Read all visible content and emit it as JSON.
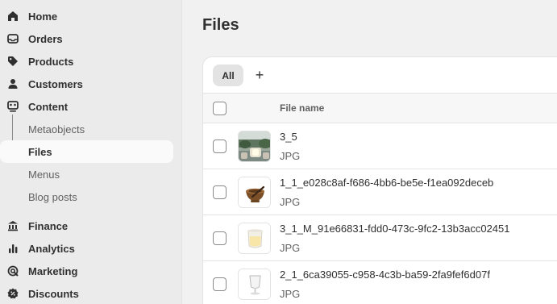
{
  "sidebar": {
    "main_items": [
      {
        "label": "Home",
        "icon": "home-icon"
      },
      {
        "label": "Orders",
        "icon": "inbox-icon"
      },
      {
        "label": "Products",
        "icon": "tag-icon"
      },
      {
        "label": "Customers",
        "icon": "person-icon"
      },
      {
        "label": "Content",
        "icon": "content-icon"
      }
    ],
    "sub_items": [
      {
        "label": "Metaobjects"
      },
      {
        "label": "Files"
      },
      {
        "label": "Menus"
      },
      {
        "label": "Blog posts"
      }
    ],
    "lower_items": [
      {
        "label": "Finance",
        "icon": "bank-icon"
      },
      {
        "label": "Analytics",
        "icon": "bar-chart-icon"
      },
      {
        "label": "Marketing",
        "icon": "target-icon"
      },
      {
        "label": "Discounts",
        "icon": "discount-icon"
      }
    ]
  },
  "main": {
    "title": "Files",
    "tabs": {
      "all_label": "All",
      "add_label": "+"
    },
    "table": {
      "column_file_name": "File name",
      "rows": [
        {
          "name": "3_5",
          "type": "JPG",
          "thumb": "patio-photo"
        },
        {
          "name": "1_1_e028c8af-f686-4bb6-be5e-f1ea092deceb",
          "type": "JPG",
          "thumb": "wooden-bowl-photo"
        },
        {
          "name": "3_1_M_91e66831-fdd0-473c-9fc2-13b3acc02451",
          "type": "JPG",
          "thumb": "glass-candle-photo"
        },
        {
          "name": "2_1_6ca39055-c958-4c3b-ba59-2fa9fef6d07f",
          "type": "JPG",
          "thumb": "clear-glass-photo"
        }
      ]
    }
  }
}
